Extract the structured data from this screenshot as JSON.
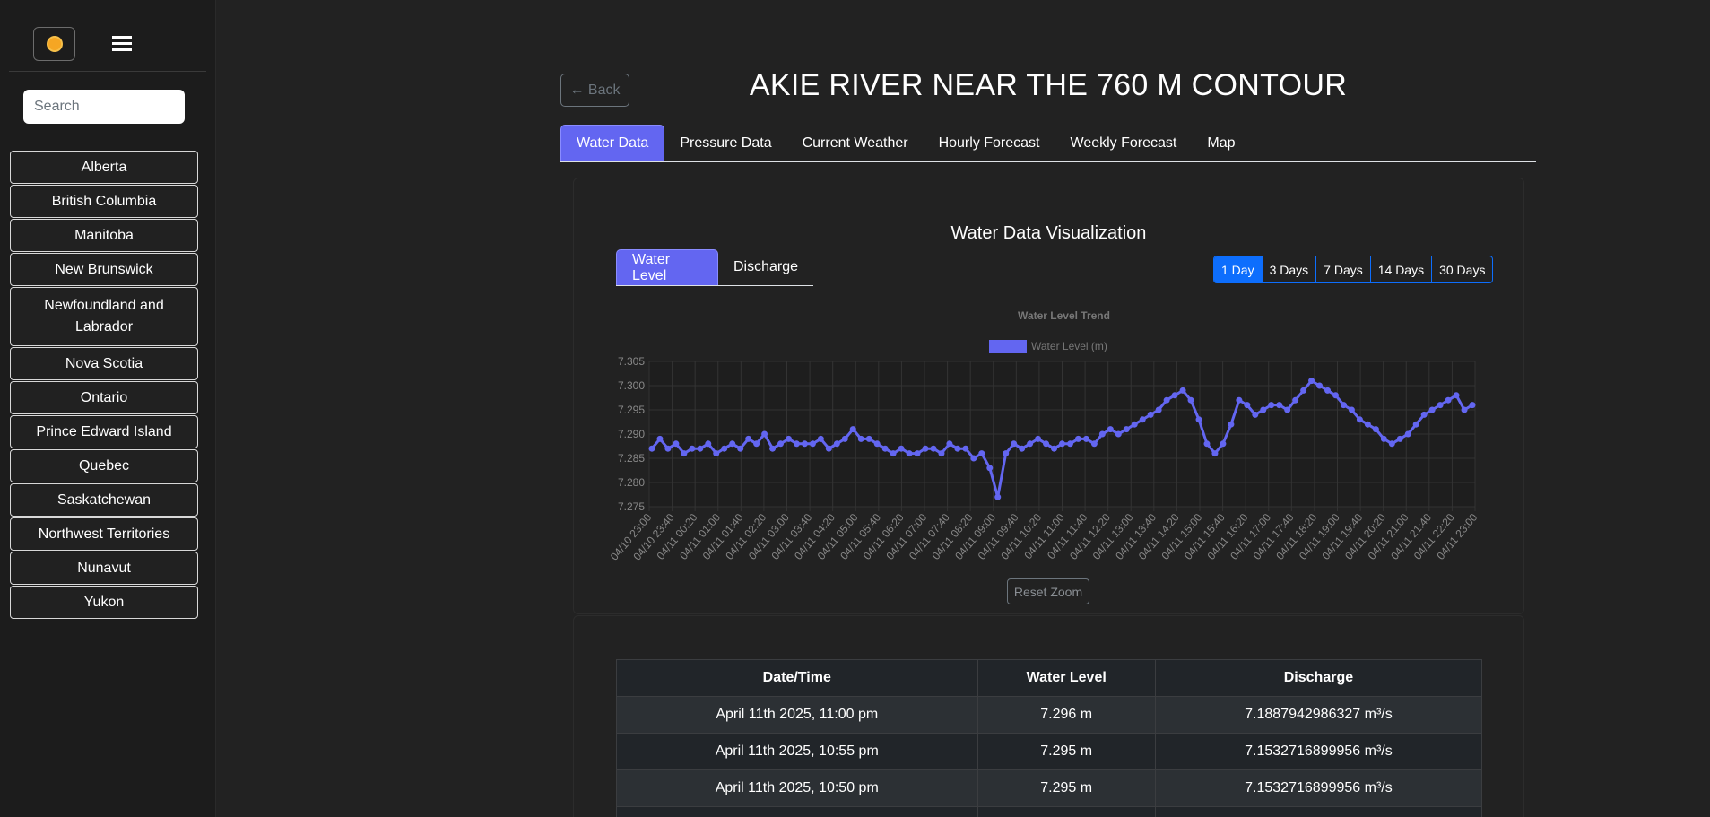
{
  "sidebar": {
    "search_placeholder": "Search",
    "provinces": [
      "Alberta",
      "British Columbia",
      "Manitoba",
      "New Brunswick",
      "Newfoundland and Labrador",
      "Nova Scotia",
      "Ontario",
      "Prince Edward Island",
      "Quebec",
      "Saskatchewan",
      "Northwest Territories",
      "Nunavut",
      "Yukon"
    ]
  },
  "header": {
    "back_label": "← Back",
    "title": "AKIE RIVER NEAR THE 760 M CONTOUR"
  },
  "tabs": [
    "Water Data",
    "Pressure Data",
    "Current Weather",
    "Hourly Forecast",
    "Weekly Forecast",
    "Map"
  ],
  "viz": {
    "title": "Water Data Visualization",
    "subtabs": [
      "Water Level",
      "Discharge"
    ],
    "ranges": [
      "1 Day",
      "3 Days",
      "7 Days",
      "14 Days",
      "30 Days"
    ],
    "reset_label": "Reset Zoom"
  },
  "chart_data": {
    "type": "line",
    "title": "Water Level Trend",
    "series": [
      {
        "name": "Water Level (m)",
        "color": "#6366f1"
      }
    ],
    "xlabel": "",
    "ylabel": "",
    "ylim": [
      7.275,
      7.305
    ],
    "yticks": [
      "7.305",
      "7.300",
      "7.295",
      "7.290",
      "7.285",
      "7.280",
      "7.275"
    ],
    "xticks": [
      "04/10 23:00",
      "04/10 23:40",
      "04/11 00:20",
      "04/11 01:00",
      "04/11 01:40",
      "04/11 02:20",
      "04/11 03:00",
      "04/11 03:40",
      "04/11 04:20",
      "04/11 05:00",
      "04/11 05:40",
      "04/11 06:20",
      "04/11 07:00",
      "04/11 07:40",
      "04/11 08:20",
      "04/11 09:00",
      "04/11 09:40",
      "04/11 10:20",
      "04/11 11:00",
      "04/11 11:40",
      "04/11 12:20",
      "04/11 13:00",
      "04/11 13:40",
      "04/11 14:20",
      "04/11 15:00",
      "04/11 15:40",
      "04/11 16:20",
      "04/11 17:00",
      "04/11 17:40",
      "04/11 18:20",
      "04/11 19:00",
      "04/11 19:40",
      "04/11 20:20",
      "04/11 21:00",
      "04/11 21:40",
      "04/11 22:20",
      "04/11 23:00"
    ],
    "values": [
      7.287,
      7.289,
      7.287,
      7.288,
      7.286,
      7.287,
      7.287,
      7.288,
      7.286,
      7.287,
      7.288,
      7.287,
      7.289,
      7.288,
      7.29,
      7.287,
      7.288,
      7.289,
      7.288,
      7.288,
      7.288,
      7.289,
      7.287,
      7.288,
      7.289,
      7.291,
      7.289,
      7.289,
      7.288,
      7.287,
      7.286,
      7.287,
      7.286,
      7.286,
      7.287,
      7.287,
      7.286,
      7.288,
      7.287,
      7.287,
      7.285,
      7.286,
      7.283,
      7.277,
      7.286,
      7.288,
      7.287,
      7.288,
      7.289,
      7.288,
      7.287,
      7.288,
      7.288,
      7.289,
      7.289,
      7.288,
      7.29,
      7.291,
      7.29,
      7.291,
      7.292,
      7.293,
      7.294,
      7.295,
      7.297,
      7.298,
      7.299,
      7.297,
      7.293,
      7.288,
      7.286,
      7.288,
      7.292,
      7.297,
      7.296,
      7.294,
      7.295,
      7.296,
      7.296,
      7.295,
      7.297,
      7.299,
      7.301,
      7.3,
      7.299,
      7.298,
      7.296,
      7.295,
      7.293,
      7.292,
      7.291,
      7.289,
      7.288,
      7.289,
      7.29,
      7.292,
      7.294,
      7.295,
      7.296,
      7.297,
      7.298,
      7.295,
      7.296
    ],
    "grid": true,
    "legend": "top"
  },
  "table": {
    "headers": [
      "Date/Time",
      "Water Level",
      "Discharge"
    ],
    "rows": [
      [
        "April 11th 2025, 11:00 pm",
        "7.296 m",
        "7.1887942986327 m³/s"
      ],
      [
        "April 11th 2025, 10:55 pm",
        "7.295 m",
        "7.1532716899956 m³/s"
      ],
      [
        "April 11th 2025, 10:50 pm",
        "7.295 m",
        "7.1532716899956 m³/s"
      ]
    ]
  }
}
